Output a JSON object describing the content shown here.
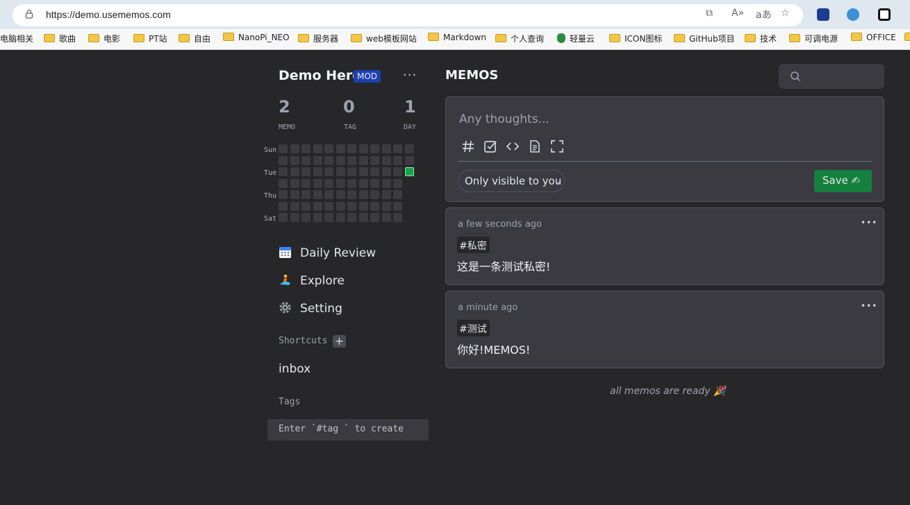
{
  "browser": {
    "url": "https://demo.usememos.com",
    "bookmarks": [
      "电脑相关",
      "歌曲",
      "电影",
      "PT站",
      "自由",
      "NanoPi_NEO",
      "服务器",
      "web模板网站",
      "Markdown",
      "个人查询",
      "轻量云",
      "ICON图标",
      "GitHub项目",
      "技术",
      "可调电源",
      "OFFICE"
    ]
  },
  "sidebar": {
    "username": "Demo Hero",
    "role_badge": "MOD",
    "more_label": "···",
    "stats": [
      {
        "value": "2",
        "label": "MEMO"
      },
      {
        "value": "0",
        "label": "TAG"
      },
      {
        "value": "1",
        "label": "DAY"
      }
    ],
    "heatmap": {
      "day_labels": [
        "Sun",
        "Tue",
        "Thu",
        "Sat"
      ],
      "active_cells": 1
    },
    "nav": [
      {
        "label": "Daily Review",
        "icon": "calendar-icon"
      },
      {
        "label": "Explore",
        "icon": "surfer-icon"
      },
      {
        "label": "Setting",
        "icon": "gear-icon"
      }
    ],
    "shortcuts_title": "Shortcuts",
    "shortcut_items": [
      "inbox"
    ],
    "tags_title": "Tags",
    "tag_hint": "Enter `#tag ` to create"
  },
  "main": {
    "title": "MEMOS",
    "editor": {
      "placeholder": "Any thoughts...",
      "toolbar_icons": [
        "hash-icon",
        "checkbox-icon",
        "code-icon",
        "document-icon",
        "fullscreen-icon"
      ],
      "visibility": "Only visible to you",
      "save_label": "Save ✍"
    },
    "memos": [
      {
        "time": "a few seconds ago",
        "tag": "#私密",
        "content": "这是一条测试私密!"
      },
      {
        "time": "a minute ago",
        "tag": "#测试",
        "content": "你好!MEMOS!"
      }
    ],
    "footer": "all memos are ready 🎉"
  },
  "colors": {
    "background": "#27272a",
    "card": "#3a3a40",
    "accent_green": "#15803d",
    "mod_badge": "#1e40af"
  }
}
